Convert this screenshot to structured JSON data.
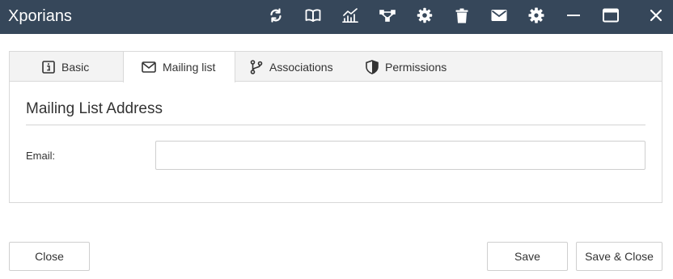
{
  "app": {
    "title": "Xporians"
  },
  "toolbar": {
    "icons": [
      "refresh-icon",
      "book-icon",
      "chart-icon",
      "workflow-icon",
      "settings-cog-icon",
      "trash-icon",
      "mail-icon",
      "gear-icon",
      "minimize-icon",
      "maximize-icon",
      "close-icon"
    ]
  },
  "tabs": [
    {
      "label": "Basic",
      "icon": "info-icon"
    },
    {
      "label": "Mailing list",
      "icon": "envelope-icon",
      "active": true
    },
    {
      "label": "Associations",
      "icon": "branch-icon"
    },
    {
      "label": "Permissions",
      "icon": "shield-icon"
    }
  ],
  "section": {
    "title": "Mailing List Address"
  },
  "form": {
    "email_label": "Email:",
    "email_value": "",
    "email_placeholder": ""
  },
  "buttons": {
    "close": "Close",
    "save": "Save",
    "save_close": "Save & Close"
  },
  "colors": {
    "titlebar": "#36475a",
    "tabstrip": "#f3f3f3",
    "border": "#d9d9d9"
  }
}
